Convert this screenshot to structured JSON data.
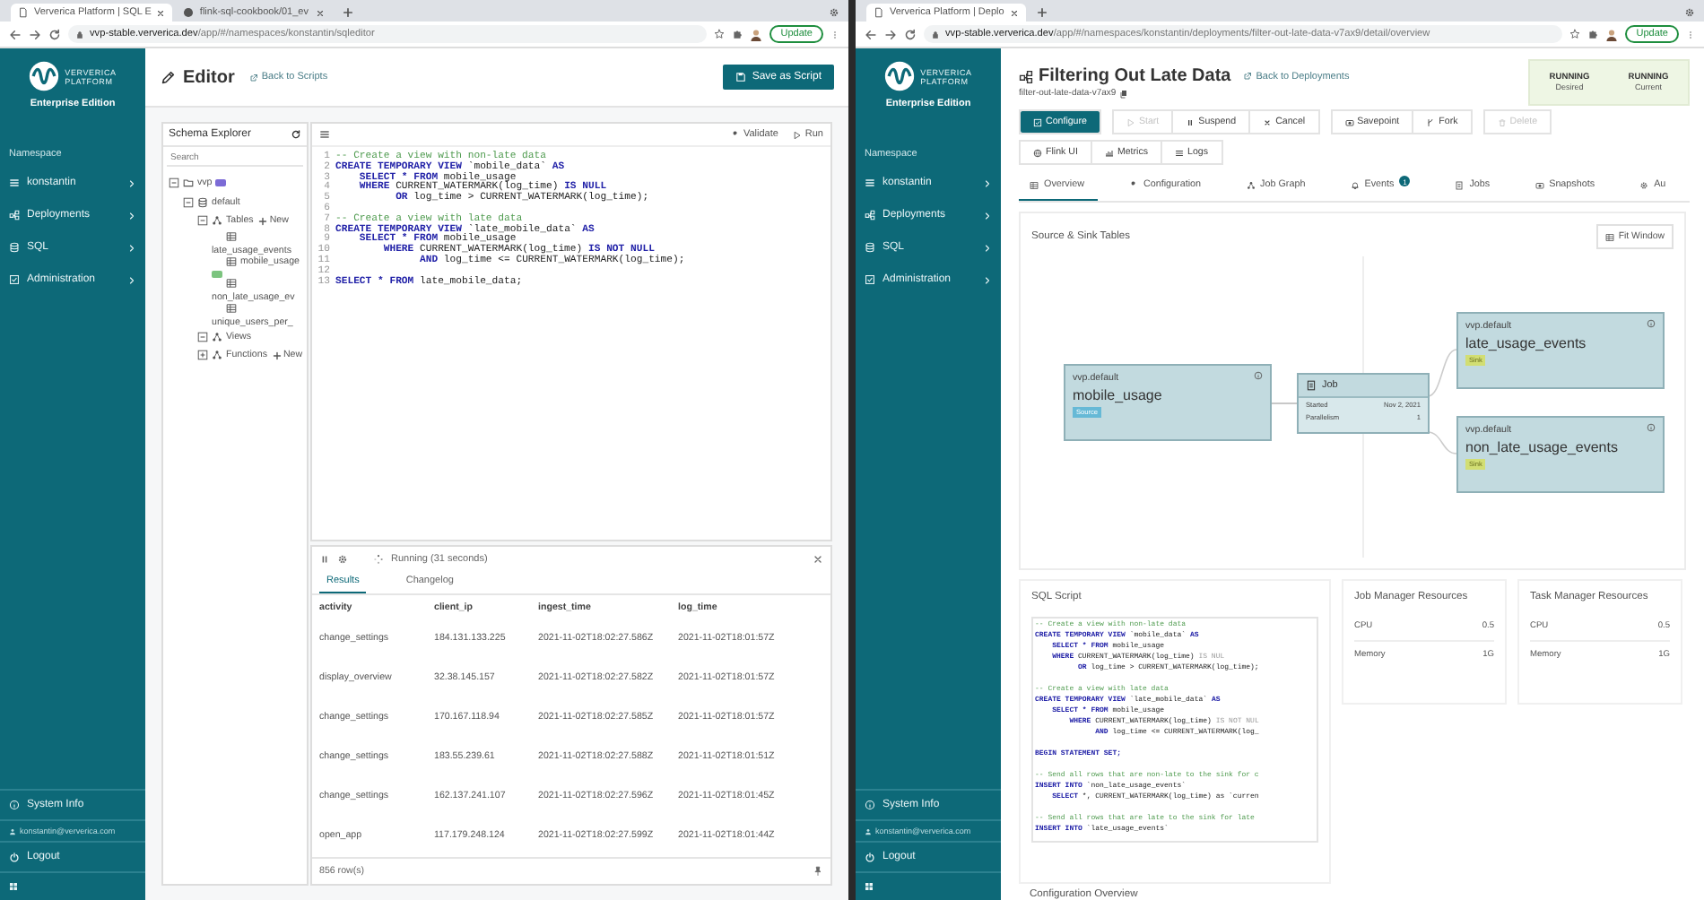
{
  "editor_window": {
    "browser": {
      "tabs": [
        {
          "title": "Ververica Platform | SQL E",
          "selected": true
        },
        {
          "title": "flink-sql-cookbook/01_ev",
          "selected": false
        }
      ],
      "address_host": "vvp-stable.ververica.dev",
      "address_path": "/app/#/namespaces/konstantin/sqleditor",
      "update_button": "Update"
    },
    "sidebar": {
      "logo_line1": "VERVERICA",
      "logo_line2": "PLATFORM",
      "edition": "Enterprise Edition",
      "section_label": "Namespace",
      "items": [
        {
          "label": "konstantin"
        },
        {
          "label": "Deployments"
        },
        {
          "label": "SQL"
        },
        {
          "label": "Administration"
        }
      ],
      "system_info": "System Info",
      "user_email": "konstantin@ververica.com",
      "logout": "Logout"
    },
    "page_title": "Editor",
    "back_link": "Back to Scripts",
    "save_button": "Save as Script",
    "schema_explorer": {
      "title": "Schema Explorer",
      "search_placeholder": "Search",
      "tree": [
        {
          "label": "vvp",
          "kind": "catalog",
          "expanded": true,
          "marked": true,
          "children": [
            {
              "label": "default",
              "kind": "database",
              "expanded": true,
              "marked": false,
              "children": [
                {
                  "label": "Tables",
                  "kind": "group",
                  "expanded": true,
                  "marked": false,
                  "action": "New",
                  "children": [
                    {
                      "label": "late_usage_events",
                      "kind": "table",
                      "marked": false
                    },
                    {
                      "label": "mobile_usage",
                      "kind": "table",
                      "marked": true
                    },
                    {
                      "label": "non_late_usage_ev",
                      "kind": "table",
                      "marked": false
                    },
                    {
                      "label": "unique_users_per_",
                      "kind": "table",
                      "marked": false
                    }
                  ]
                },
                {
                  "label": "Views",
                  "kind": "group",
                  "expanded": true,
                  "marked": false
                },
                {
                  "label": "Functions",
                  "kind": "group",
                  "expanded": false,
                  "marked": false,
                  "action": "New"
                }
              ]
            }
          ]
        }
      ]
    },
    "editor": {
      "validate_button": "Validate",
      "run_button": "Run",
      "lines": [
        {
          "number": "1",
          "segments": [
            {
              "kind": "comment",
              "text": "-- Create a view with non-late data"
            }
          ]
        },
        {
          "number": "2",
          "segments": [
            {
              "kind": "keyword",
              "text": "CREATE TEMPORARY VIEW"
            },
            {
              "kind": "plain",
              "text": " `mobile_data` "
            },
            {
              "kind": "keyword",
              "text": "AS"
            }
          ]
        },
        {
          "number": "3",
          "segments": [
            {
              "kind": "keyword",
              "text": "    SELECT * FROM"
            },
            {
              "kind": "plain",
              "text": " mobile_usage"
            }
          ]
        },
        {
          "number": "4",
          "segments": [
            {
              "kind": "keyword",
              "text": "    WHERE"
            },
            {
              "kind": "plain",
              "text": " CURRENT_WATERMARK(log_time) "
            },
            {
              "kind": "keyword",
              "text": "IS NULL"
            }
          ]
        },
        {
          "number": "5",
          "segments": [
            {
              "kind": "keyword",
              "text": "          OR"
            },
            {
              "kind": "plain",
              "text": " log_time > CURRENT_WATERMARK(log_time);"
            }
          ]
        },
        {
          "number": "6"
        },
        {
          "number": "7",
          "segments": [
            {
              "kind": "comment",
              "text": "-- Create a view with late data"
            }
          ]
        },
        {
          "number": "8",
          "segments": [
            {
              "kind": "keyword",
              "text": "CREATE TEMPORARY VIEW"
            },
            {
              "kind": "plain",
              "text": " `late_mobile_data` "
            },
            {
              "kind": "keyword",
              "text": "AS"
            }
          ]
        },
        {
          "number": "9",
          "segments": [
            {
              "kind": "keyword",
              "text": "    SELECT * FROM"
            },
            {
              "kind": "plain",
              "text": " mobile_usage"
            }
          ]
        },
        {
          "number": "10",
          "segments": [
            {
              "kind": "keyword",
              "text": "        WHERE"
            },
            {
              "kind": "plain",
              "text": " CURRENT_WATERMARK(log_time) "
            },
            {
              "kind": "keyword",
              "text": "IS NOT NULL"
            }
          ]
        },
        {
          "number": "11",
          "segments": [
            {
              "kind": "keyword",
              "text": "              AND"
            },
            {
              "kind": "plain",
              "text": " log_time <= CURRENT_WATERMARK(log_time);"
            }
          ]
        },
        {
          "number": "12"
        },
        {
          "number": "13",
          "segments": [
            {
              "kind": "keyword",
              "text": "SELECT * FROM"
            },
            {
              "kind": "plain",
              "text": " late_mobile_data;"
            }
          ]
        }
      ]
    },
    "results": {
      "status": "Running (31 seconds)",
      "tabs": [
        {
          "label": "Results",
          "selected": true
        },
        {
          "label": "Changelog",
          "selected": false
        }
      ],
      "columns": [
        "activity",
        "client_ip",
        "ingest_time",
        "log_time"
      ],
      "rows": [
        [
          "change_settings",
          "184.131.133.225",
          "2021-11-02T18:02:27.586Z",
          "2021-11-02T18:01:57Z"
        ],
        [
          "display_overview",
          "32.38.145.157",
          "2021-11-02T18:02:27.582Z",
          "2021-11-02T18:01:57Z"
        ],
        [
          "change_settings",
          "170.167.118.94",
          "2021-11-02T18:02:27.585Z",
          "2021-11-02T18:01:57Z"
        ],
        [
          "change_settings",
          "183.55.239.61",
          "2021-11-02T18:02:27.588Z",
          "2021-11-02T18:01:51Z"
        ],
        [
          "change_settings",
          "162.137.241.107",
          "2021-11-02T18:02:27.596Z",
          "2021-11-02T18:01:45Z"
        ],
        [
          "open_app",
          "117.179.248.124",
          "2021-11-02T18:02:27.599Z",
          "2021-11-02T18:01:44Z"
        ]
      ],
      "row_count": "856 row(s)"
    }
  },
  "deployment_window": {
    "browser": {
      "tabs": [
        {
          "title": "Ververica Platform | Deplo",
          "selected": true
        }
      ],
      "address_host": "vvp-stable.ververica.dev",
      "address_path": "/app/#/namespaces/konstantin/deployments/filter-out-late-data-v7ax9/detail/overview",
      "update_button": "Update"
    },
    "sidebar": {
      "logo_line1": "VERVERICA",
      "logo_line2": "PLATFORM",
      "edition": "Enterprise Edition",
      "section_label": "Namespace",
      "items": [
        {
          "label": "konstantin"
        },
        {
          "label": "Deployments"
        },
        {
          "label": "SQL"
        },
        {
          "label": "Administration"
        }
      ],
      "system_info": "System Info",
      "user_email": "konstantin@ververica.com",
      "logout": "Logout"
    },
    "header": {
      "title": "Filtering Out Late Data",
      "back_link": "Back to Deployments",
      "deployment_id": "filter-out-late-data-v7ax9",
      "states": [
        {
          "value": "RUNNING",
          "label": "Desired"
        },
        {
          "value": "RUNNING",
          "label": "Current"
        }
      ]
    },
    "action_groups": [
      [
        {
          "label": "Configure",
          "kind": "primary",
          "disabled": false
        }
      ],
      [
        {
          "label": "Start",
          "kind": "default",
          "disabled": true
        },
        {
          "label": "Suspend",
          "kind": "default",
          "disabled": false
        },
        {
          "label": "Cancel",
          "kind": "default",
          "disabled": false
        }
      ],
      [
        {
          "label": "Savepoint",
          "kind": "default",
          "disabled": false
        },
        {
          "label": "Fork",
          "kind": "default",
          "disabled": false
        }
      ],
      [
        {
          "label": "Delete",
          "kind": "default",
          "disabled": true
        }
      ]
    ],
    "link_buttons": [
      {
        "label": "Flink UI"
      },
      {
        "label": "Metrics"
      },
      {
        "label": "Logs"
      }
    ],
    "tabs": [
      {
        "label": "Overview",
        "selected": true
      },
      {
        "label": "Configuration",
        "selected": false
      },
      {
        "label": "Job Graph",
        "selected": false
      },
      {
        "label": "Events",
        "selected": false,
        "badge": "1"
      },
      {
        "label": "Jobs",
        "selected": false
      },
      {
        "label": "Snapshots",
        "selected": false
      },
      {
        "label": "Au",
        "selected": false
      }
    ],
    "graph_card": {
      "title": "Source & Sink Tables",
      "fit_button": "Fit Window",
      "sources": [
        {
          "catalog": "vvp.default",
          "name": "mobile_usage",
          "tag": "Source"
        }
      ],
      "job": {
        "title": "Job",
        "rows": [
          {
            "label": "Started",
            "value": "Nov 2, 2021"
          },
          {
            "label": "Parallelism",
            "value": "1"
          }
        ]
      },
      "sinks": [
        {
          "catalog": "vvp.default",
          "name": "late_usage_events",
          "tag": "Sink"
        },
        {
          "catalog": "vvp.default",
          "name": "non_late_usage_events",
          "tag": "Sink"
        }
      ]
    },
    "sql_card": {
      "title": "SQL Script",
      "lines": [
        {
          "segments": [
            {
              "kind": "comment",
              "text": "-- Create a view with non-late data"
            }
          ]
        },
        {
          "segments": [
            {
              "kind": "keyword",
              "text": "CREATE TEMPORARY VIEW"
            },
            {
              "kind": "plain",
              "text": " `mobile_data` "
            },
            {
              "kind": "keyword",
              "text": "AS"
            }
          ]
        },
        {
          "segments": [
            {
              "kind": "keyword",
              "text": "    SELECT * FROM"
            },
            {
              "kind": "plain",
              "text": " mobile_usage"
            }
          ]
        },
        {
          "segments": [
            {
              "kind": "keyword",
              "text": "    WHERE"
            },
            {
              "kind": "plain",
              "text": " CURRENT_WATERMARK(log_time) "
            },
            {
              "kind": "muted",
              "text": "IS NUL"
            }
          ]
        },
        {
          "segments": [
            {
              "kind": "keyword",
              "text": "          OR"
            },
            {
              "kind": "plain",
              "text": " log_time > CURRENT_WATERMARK(log_time);"
            }
          ]
        },
        {
          "blank": true
        },
        {
          "segments": [
            {
              "kind": "comment",
              "text": "-- Create a view with late data"
            }
          ]
        },
        {
          "segments": [
            {
              "kind": "keyword",
              "text": "CREATE TEMPORARY VIEW"
            },
            {
              "kind": "plain",
              "text": " `late_mobile_data` "
            },
            {
              "kind": "keyword",
              "text": "AS"
            }
          ]
        },
        {
          "segments": [
            {
              "kind": "keyword",
              "text": "    SELECT * FROM"
            },
            {
              "kind": "plain",
              "text": " mobile_usage"
            }
          ]
        },
        {
          "segments": [
            {
              "kind": "keyword",
              "text": "        WHERE"
            },
            {
              "kind": "plain",
              "text": " CURRENT_WATERMARK(log_time) "
            },
            {
              "kind": "muted",
              "text": "IS NOT NUL"
            }
          ]
        },
        {
          "segments": [
            {
              "kind": "keyword",
              "text": "              AND"
            },
            {
              "kind": "plain",
              "text": " log_time <= CURRENT_WATERMARK(log_"
            }
          ]
        },
        {
          "blank": true
        },
        {
          "segments": [
            {
              "kind": "keyword",
              "text": "BEGIN STATEMENT SET;"
            }
          ]
        },
        {
          "blank": true
        },
        {
          "segments": [
            {
              "kind": "comment",
              "text": "-- Send all rows that are non-late to the sink for c"
            }
          ]
        },
        {
          "segments": [
            {
              "kind": "keyword",
              "text": "INSERT INTO"
            },
            {
              "kind": "plain",
              "text": " `non_late_usage_events`"
            }
          ]
        },
        {
          "segments": [
            {
              "kind": "keyword",
              "text": "    SELECT"
            },
            {
              "kind": "plain",
              "text": " *, CURRENT_WATERMARK(log_time) as `curren"
            }
          ]
        },
        {
          "blank": true
        },
        {
          "segments": [
            {
              "kind": "comment",
              "text": "-- Send all rows that are late to the sink for late"
            }
          ]
        },
        {
          "segments": [
            {
              "kind": "keyword",
              "text": "INSERT INTO"
            },
            {
              "kind": "plain",
              "text": " `late_usage_events`"
            }
          ]
        }
      ]
    },
    "resource_cards": [
      {
        "title": "Job Manager Resources",
        "rows": [
          {
            "label": "CPU",
            "value": "0.5"
          },
          {
            "label": "Memory",
            "value": "1G"
          }
        ]
      },
      {
        "title": "Task Manager Resources",
        "rows": [
          {
            "label": "CPU",
            "value": "0.5"
          },
          {
            "label": "Memory",
            "value": "1G"
          }
        ]
      }
    ],
    "section_heading": "Configuration Overview"
  }
}
